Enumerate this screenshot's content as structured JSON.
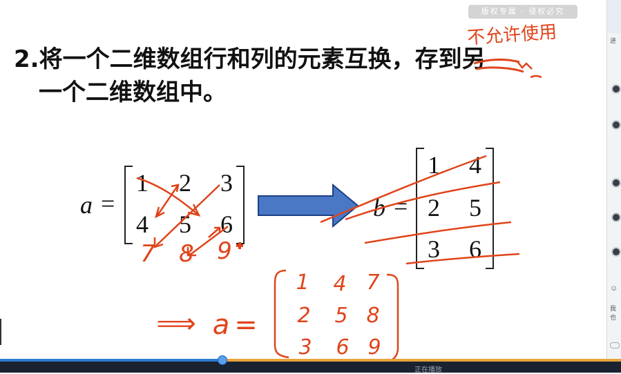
{
  "watermark": "版权专属 · 侵权必究",
  "title": {
    "line1": "2.将一个二维数组行和列的元素互换，存到另",
    "line2": "一个二维数组中。"
  },
  "annotation_top": "不允许使用",
  "matrix_a": {
    "label": "a",
    "equals": "=",
    "rows": [
      [
        "1",
        "2",
        "3"
      ],
      [
        "4",
        "5",
        "6"
      ]
    ]
  },
  "matrix_b": {
    "label": "b",
    "equals": "=",
    "rows": [
      [
        "1",
        "4"
      ],
      [
        "2",
        "5"
      ],
      [
        "3",
        "6"
      ]
    ]
  },
  "handwritten_below_a": [
    "7",
    "8",
    "9"
  ],
  "handwritten_result": {
    "arrow": "⟹",
    "label": "a",
    "equals": "=",
    "rows": [
      [
        "1",
        "4",
        "7"
      ],
      [
        "2",
        "5",
        "8"
      ],
      [
        "3",
        "6",
        "9"
      ]
    ]
  },
  "right_panel": {
    "top_text": "进",
    "chat_text": "我也"
  },
  "bottom_bar": {
    "text": "正在播放"
  },
  "colors": {
    "ink": "#e0441a",
    "arrow_fill": "#4a78c4",
    "arrow_stroke": "#1b3f86",
    "progress": "#2e7ad1"
  }
}
